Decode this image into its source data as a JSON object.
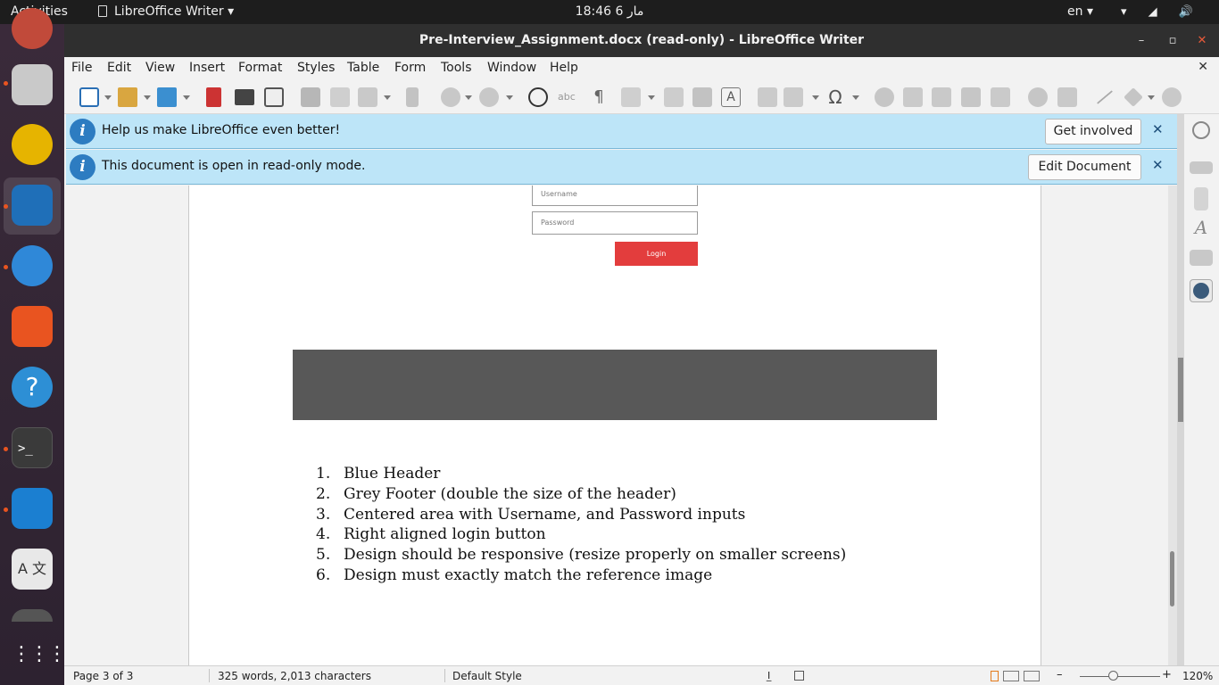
{
  "topbar": {
    "activities": "Activities",
    "app_name": "LibreOffice Writer",
    "clock": "18:46  6 مار",
    "language": "en",
    "system_icons": "▾ ◢ 🔊 ⏻ ▾"
  },
  "dock": {
    "apps": [
      {
        "name": "files",
        "color": "#c9c9c9"
      },
      {
        "name": "rhythmbox",
        "color": "#e6b400"
      },
      {
        "name": "libreoffice-writer",
        "color": "#1f6fb8"
      },
      {
        "name": "thunderbird",
        "color": "#2f88d8"
      },
      {
        "name": "ubuntu-software",
        "color": "#e95420"
      },
      {
        "name": "help",
        "color": "#2d8fd5"
      },
      {
        "name": "terminal",
        "color": "#3a3a3a"
      },
      {
        "name": "vscode",
        "color": "#1b7fd1"
      },
      {
        "name": "translate",
        "color": "#e8e8e8"
      }
    ],
    "show_apps": "⋮⋮⋮"
  },
  "window": {
    "title": "Pre-Interview_Assignment.docx (read-only) - LibreOffice Writer",
    "minimize": "–",
    "maximize": "▫",
    "close": "✕"
  },
  "menubar": {
    "items": [
      "File",
      "Edit",
      "View",
      "Insert",
      "Format",
      "Styles",
      "Table",
      "Form",
      "Tools",
      "Window",
      "Help"
    ],
    "close": "✕"
  },
  "infobars": [
    {
      "message": "Help us make LibreOffice even better!",
      "button": "Get involved",
      "icon": "i",
      "close": "✕"
    },
    {
      "message": "This document is open in read-only mode.",
      "button": "Edit Document",
      "icon": "i",
      "close": "✕"
    }
  ],
  "document": {
    "mock_username_placeholder": "Username",
    "mock_password_placeholder": "Password",
    "mock_login_label": "Login",
    "requirements": [
      {
        "num": "1.",
        "text": "Blue Header"
      },
      {
        "num": "2.",
        "text": "Grey Footer (double the size of the header)"
      },
      {
        "num": "3.",
        "text": "Centered area with Username, and Password inputs"
      },
      {
        "num": "4.",
        "text": "Right aligned login button"
      },
      {
        "num": "5.",
        "text": "Design should be responsive (resize properly on smaller screens)"
      },
      {
        "num": "6.",
        "text": "Design must exactly match the reference image"
      }
    ]
  },
  "statusbar": {
    "page": "Page 3 of 3",
    "words": "325 words, 2,013 characters",
    "style": "Default Style",
    "zoom": "120%",
    "zoom_minus": "–",
    "zoom_plus": "+"
  },
  "colors": {
    "infobar_bg": "#bde5f8",
    "info_icon": "#2d7cc1",
    "mock_login_button": "#e33d3d",
    "mock_footer": "#585858",
    "ubuntu_accent": "#e95420"
  }
}
